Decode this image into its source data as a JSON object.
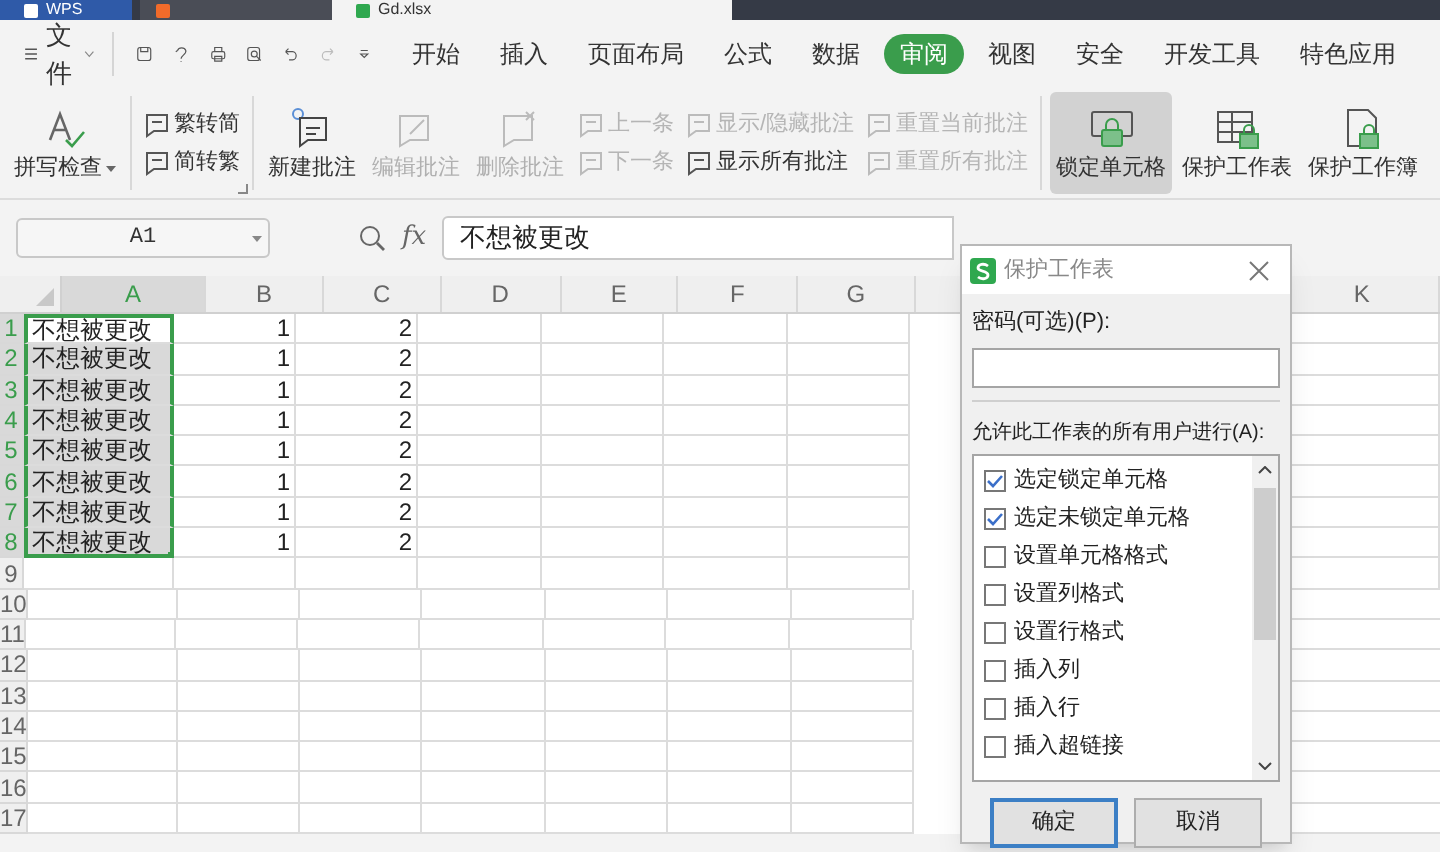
{
  "app_tabs": [
    {
      "label": "WPS",
      "selected": false
    },
    {
      "label": "Gd.xlsx",
      "selected": true
    }
  ],
  "menu": {
    "file": "文件",
    "tabs": [
      {
        "label": "开始",
        "selected": false
      },
      {
        "label": "插入",
        "selected": false
      },
      {
        "label": "页面布局",
        "selected": false
      },
      {
        "label": "公式",
        "selected": false
      },
      {
        "label": "数据",
        "selected": false
      },
      {
        "label": "审阅",
        "selected": true
      },
      {
        "label": "视图",
        "selected": false
      },
      {
        "label": "安全",
        "selected": false
      },
      {
        "label": "开发工具",
        "selected": false
      },
      {
        "label": "特色应用",
        "selected": false
      }
    ]
  },
  "ribbon": [
    {
      "items": [
        {
          "kind": "large",
          "label": "拼写检查",
          "dropdown": true,
          "disabled": false,
          "selected": false
        }
      ]
    },
    {
      "items": [
        {
          "kind": "stack",
          "items": [
            {
              "label": "繁转简",
              "disabled": false
            },
            {
              "label": "简转繁",
              "disabled": false
            }
          ]
        }
      ]
    },
    {
      "items": [
        {
          "kind": "large",
          "label": "新建批注",
          "dropdown": false,
          "disabled": false,
          "selected": false
        },
        {
          "kind": "large",
          "label": "编辑批注",
          "dropdown": false,
          "disabled": true,
          "selected": false
        },
        {
          "kind": "large",
          "label": "删除批注",
          "dropdown": false,
          "disabled": true,
          "selected": false
        },
        {
          "kind": "stack",
          "items": [
            {
              "label": "上一条",
              "disabled": true
            },
            {
              "label": "下一条",
              "disabled": true
            }
          ]
        },
        {
          "kind": "stack",
          "items": [
            {
              "label": "显示/隐藏批注",
              "disabled": true
            },
            {
              "label": "显示所有批注",
              "disabled": false
            }
          ]
        },
        {
          "kind": "stack",
          "items": [
            {
              "label": "重置当前批注",
              "disabled": true
            },
            {
              "label": "重置所有批注",
              "disabled": true
            }
          ]
        }
      ]
    },
    {
      "items": [
        {
          "kind": "large",
          "label": "锁定单元格",
          "dropdown": false,
          "disabled": false,
          "selected": true
        },
        {
          "kind": "large",
          "label": "保护工作表",
          "dropdown": false,
          "disabled": false,
          "selected": false
        },
        {
          "kind": "large",
          "label": "保护工作簿",
          "dropdown": false,
          "disabled": false,
          "selected": false
        }
      ]
    }
  ],
  "formula_bar": {
    "name_box": "A1",
    "fx": "fx",
    "value": "不想被更改"
  },
  "sheet": {
    "columns": [
      {
        "label": "A",
        "selected": true
      },
      {
        "label": "B",
        "selected": false
      },
      {
        "label": "C",
        "selected": false
      },
      {
        "label": "D",
        "selected": false
      },
      {
        "label": "E",
        "selected": false
      },
      {
        "label": "F",
        "selected": false
      },
      {
        "label": "G",
        "selected": false
      },
      {
        "label": "K",
        "selected": false
      }
    ],
    "rows": [
      {
        "header": "1",
        "selected": true,
        "cells": [
          "不想被更改",
          "1",
          "2"
        ]
      },
      {
        "header": "2",
        "selected": true,
        "cells": [
          "不想被更改",
          "1",
          "2"
        ]
      },
      {
        "header": "3",
        "selected": true,
        "cells": [
          "不想被更改",
          "1",
          "2"
        ]
      },
      {
        "header": "4",
        "selected": true,
        "cells": [
          "不想被更改",
          "1",
          "2"
        ]
      },
      {
        "header": "5",
        "selected": true,
        "cells": [
          "不想被更改",
          "1",
          "2"
        ]
      },
      {
        "header": "6",
        "selected": true,
        "cells": [
          "不想被更改",
          "1",
          "2"
        ]
      },
      {
        "header": "7",
        "selected": true,
        "cells": [
          "不想被更改",
          "1",
          "2"
        ]
      },
      {
        "header": "8",
        "selected": true,
        "cells": [
          "不想被更改",
          "1",
          "2"
        ]
      },
      {
        "header": "9",
        "selected": false
      },
      {
        "header": "10",
        "selected": false
      },
      {
        "header": "11",
        "selected": false
      },
      {
        "header": "12",
        "selected": false
      },
      {
        "header": "13",
        "selected": false
      },
      {
        "header": "14",
        "selected": false
      },
      {
        "header": "15",
        "selected": false
      },
      {
        "header": "16",
        "selected": false
      },
      {
        "header": "17",
        "selected": false
      }
    ]
  },
  "dialog": {
    "title": "保护工作表",
    "password_label": "密码(可选)(P):",
    "allow_label": "允许此工作表的所有用户进行(A):",
    "options": [
      {
        "label": "选定锁定单元格",
        "checked": true
      },
      {
        "label": "选定未锁定单元格",
        "checked": true
      },
      {
        "label": "设置单元格格式",
        "checked": false
      },
      {
        "label": "设置列格式",
        "checked": false
      },
      {
        "label": "设置行格式",
        "checked": false
      },
      {
        "label": "插入列",
        "checked": false
      },
      {
        "label": "插入行",
        "checked": false
      },
      {
        "label": "插入超链接",
        "checked": false
      }
    ],
    "buttons": [
      {
        "label": "确定",
        "selected": true
      },
      {
        "label": "取消",
        "selected": false
      }
    ]
  }
}
